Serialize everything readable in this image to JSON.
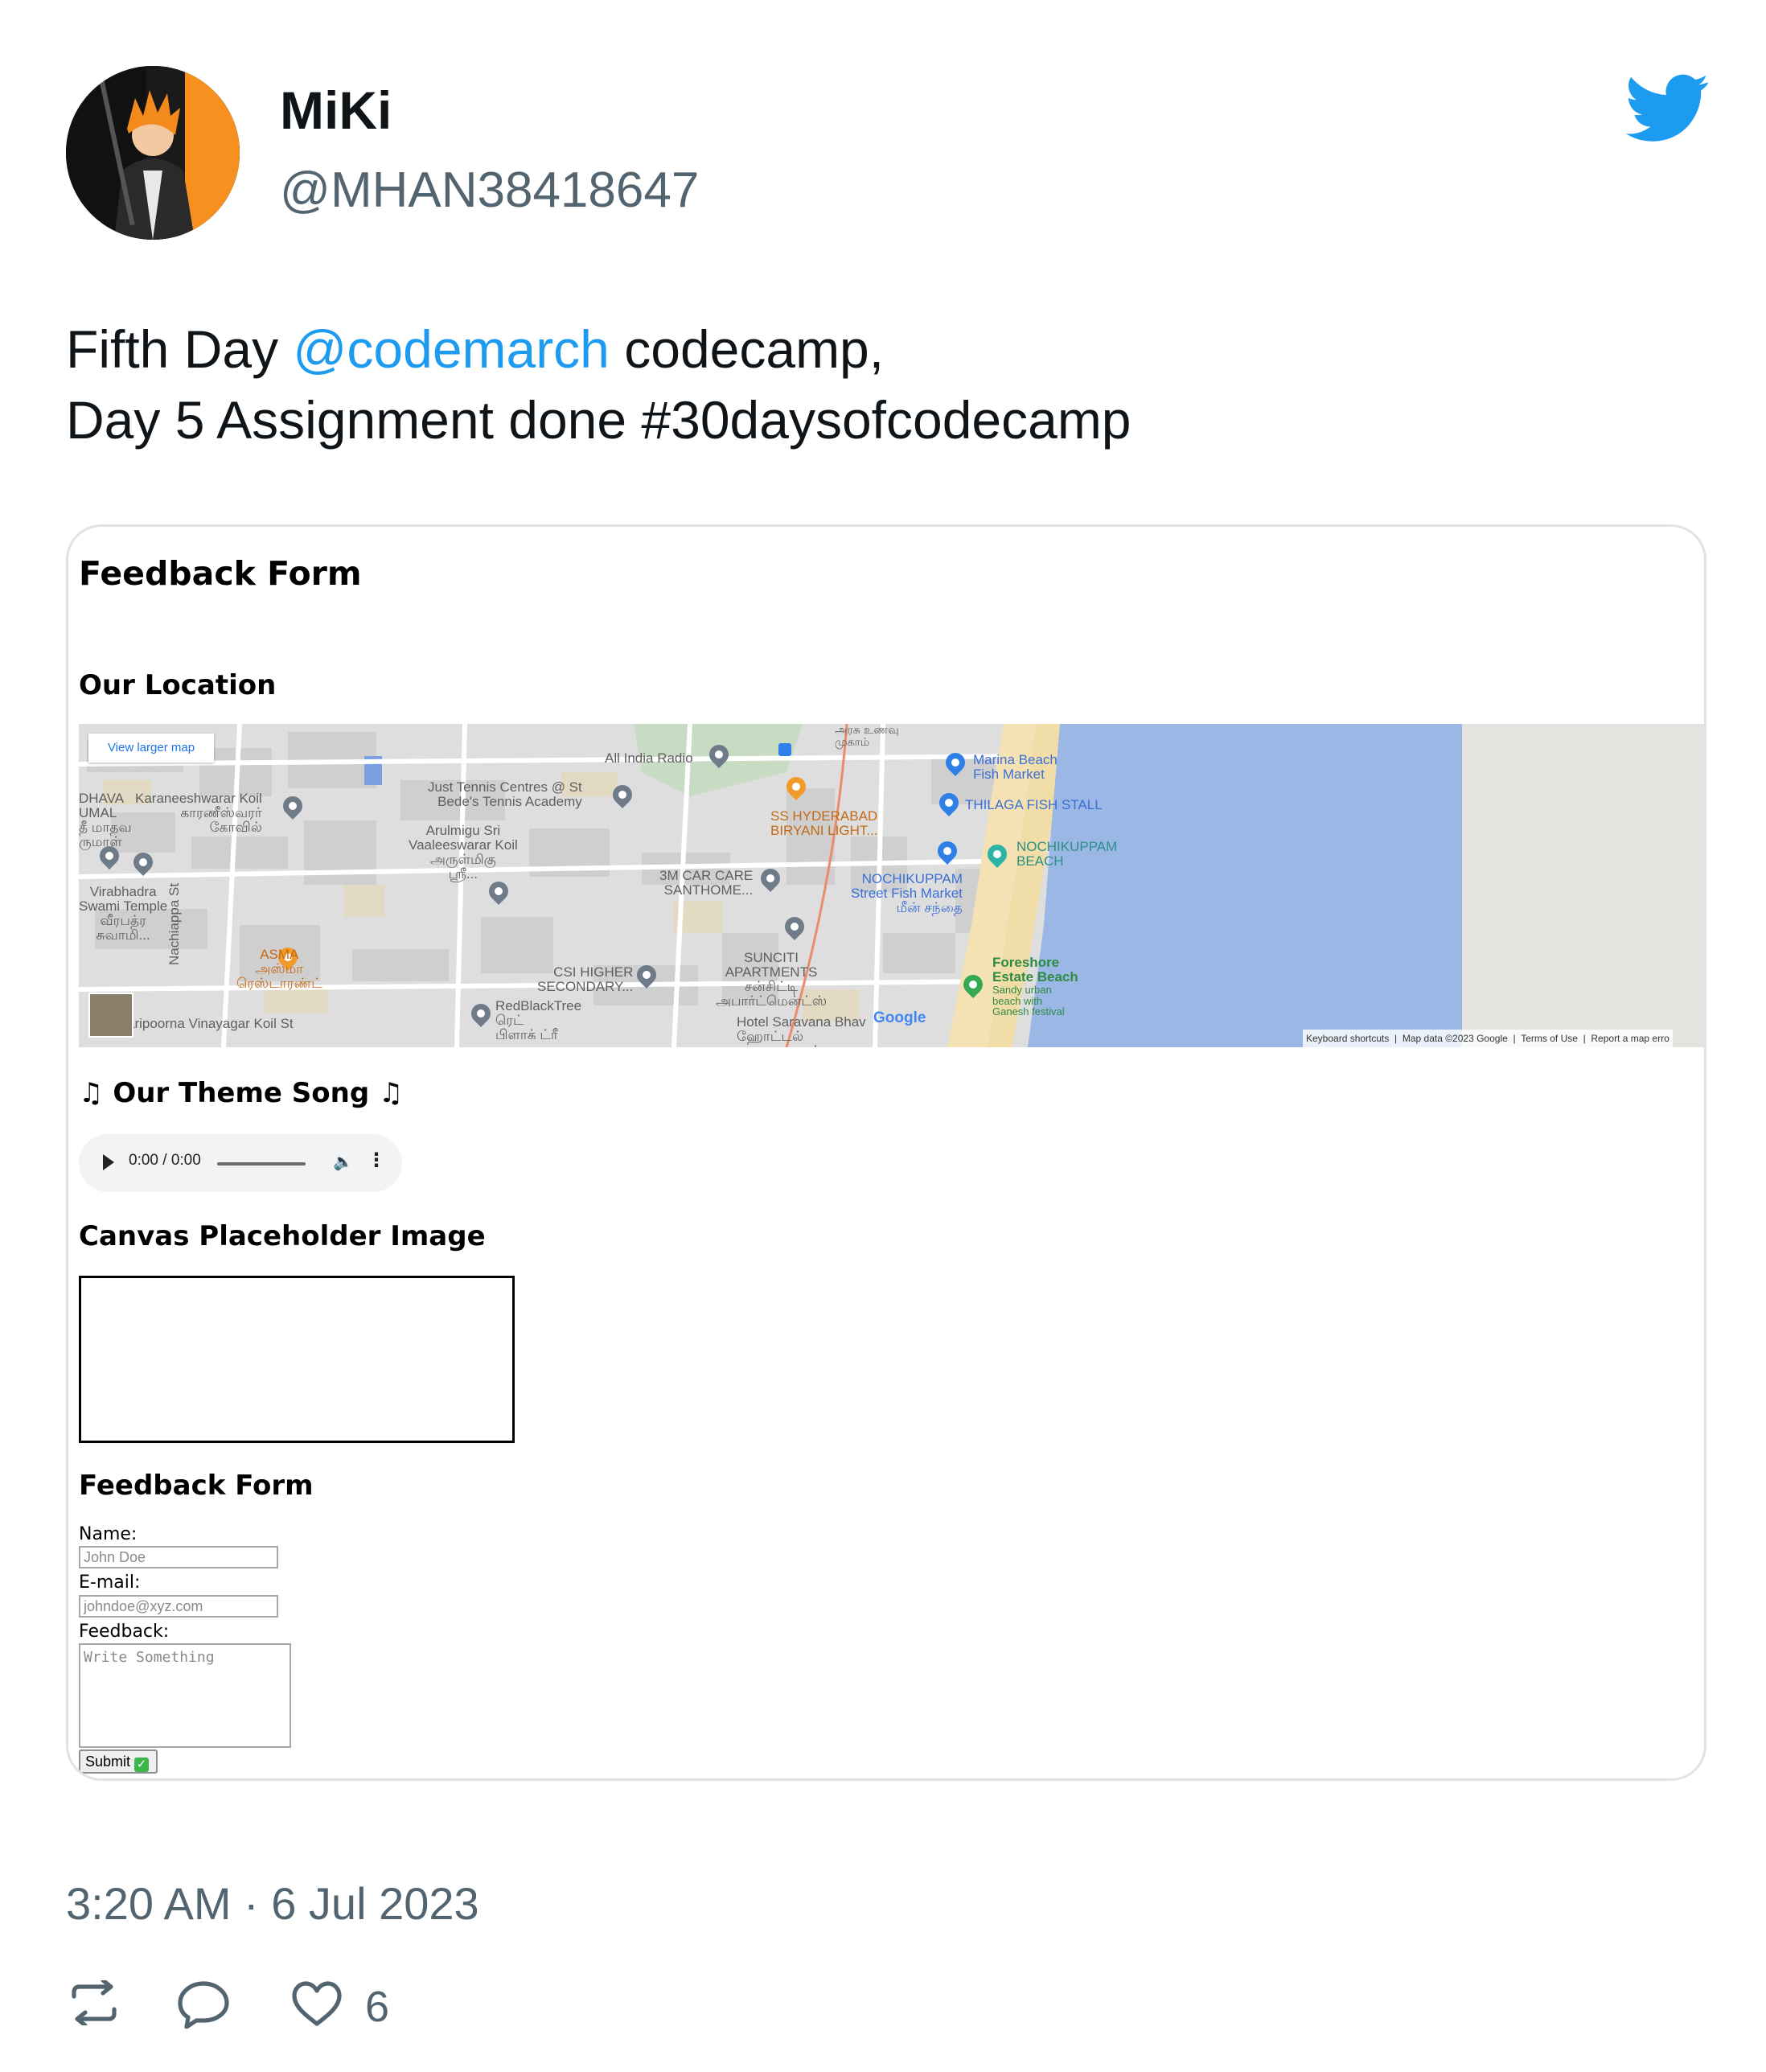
{
  "author": {
    "display_name": "MiKi",
    "handle": "@MHAN38418647"
  },
  "tweet": {
    "line1_pre": "Fifth Day ",
    "mention": "@codemarch",
    "line1_post": " codecamp,",
    "line2": "Day 5 Assignment done #30daysofcodecamp",
    "timestamp": "3:20 AM · 6 Jul 2023",
    "like_count": "6"
  },
  "screenshot": {
    "page_title": "Feedback Form",
    "location_heading": "Our Location",
    "map": {
      "view_larger": "View larger map",
      "labels": {
        "all_india_radio": "All India Radio",
        "just_tennis": "Just Tennis Centres @ St\nBede's Tennis Academy",
        "arulmigu": "Arulmigu Sri\nVaaleeswarar Koil\nஅருள்மிகு\nஸ்ரீ...",
        "karaneeshwarar": "Karaneeshwarar Koil\nகாரணீஸ்வரர்\nகோவில்",
        "dhava": "DHAVA\nUMAL\nதீ மாதவ\nருமாள்",
        "virabhadra": "Virabhadra\nSwami Temple\nவீரபத்ர\nசுவாமி...",
        "asma": "ASMA\nஅஸ்மா\nரெஸ்டாரண்ட்",
        "nachiappa": "Nachiappa St",
        "vinayagar": "aripoorna Vinayagar Koil St",
        "csi": "CSI HIGHER\nSECONDARY...",
        "redblacktree": "RedBlackTree\nரெட்\nபிளாக் ட்ரீ",
        "car_care": "3M CAR CARE\nSANTHOME...",
        "ss_hyderabad": "SS HYDERABAD\nBIRYANI LIGHT...",
        "suncity": "SUNCITI\nAPARTMENTS\nசன்சிட்டி\nஅபார்ட்மென்ட்ஸ்",
        "hotel_saravana": "Hotel Saravana Bhav\nஹோட்டல்\nசரவண பவன்",
        "nochikuppam_market": "NOCHIKUPPAM\nStreet Fish Market\nமீன் சந்தை",
        "marina_fish": "Marina Beach\nFish Market",
        "thilaga": "THILAGA FISH STALL",
        "nochikuppam_beach": "NOCHIKUPPAM\nBEACH",
        "foreshore": "Foreshore\nEstate Beach",
        "foreshore_sub": "Sandy urban\nbeach with\nGanesh festival",
        "arasu": "அரசு உணவு\nமுகாம்",
        "google": "Google"
      },
      "attribution": {
        "keyboard": "Keyboard shortcuts",
        "map_data": "Map data ©2023 Google",
        "terms": "Terms of Use",
        "report": "Report a map erro"
      },
      "colors": {
        "sea": "#9bb7e6",
        "sand": "#f6e3b8",
        "land": "#dcdcdc",
        "grey_water": "#e5e3df"
      }
    },
    "theme_heading": "♫ Our Theme Song ♫",
    "audio": {
      "time": "0:00 / 0:00"
    },
    "canvas_heading": "Canvas Placeholder Image",
    "form": {
      "heading": "Feedback Form",
      "name_label": "Name:",
      "name_placeholder": "John Doe",
      "email_label": "E-mail:",
      "email_placeholder": "johndoe@xyz.com",
      "feedback_label": "Feedback:",
      "feedback_placeholder": "Write Something",
      "submit_label": "Submit"
    }
  },
  "colors": {
    "link": "#1d9bf0",
    "muted": "#536471",
    "twitter_blue": "#1d9bf0"
  }
}
